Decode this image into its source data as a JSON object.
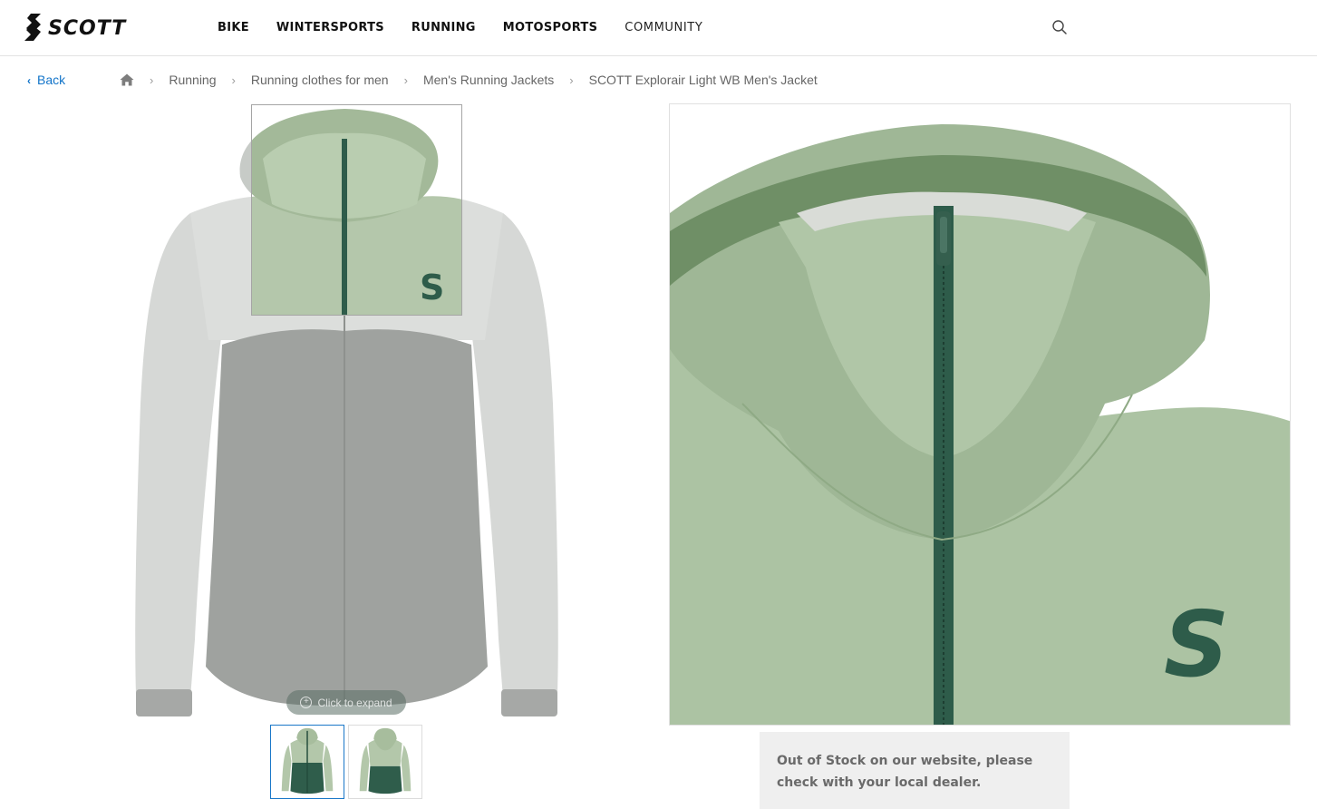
{
  "header": {
    "logo_text": "SCOTT",
    "nav": [
      {
        "label": "BIKE"
      },
      {
        "label": "WINTERSPORTS"
      },
      {
        "label": "RUNNING"
      },
      {
        "label": "MOTOSPORTS"
      },
      {
        "label": "COMMUNITY"
      }
    ],
    "search_icon": "search-icon"
  },
  "breadcrumb": {
    "back_label": "Back",
    "home_icon": "home-icon",
    "items": [
      {
        "label": "Running"
      },
      {
        "label": "Running clothes for men"
      },
      {
        "label": "Men's Running Jackets"
      },
      {
        "label": "SCOTT Explorair Light WB Men's Jacket"
      }
    ]
  },
  "gallery": {
    "expand_label": "Click to expand",
    "thumbnails": [
      {
        "view": "front",
        "selected": true
      },
      {
        "view": "back",
        "selected": false
      }
    ]
  },
  "stock_notice": "Out of Stock on our website, please check with your local dealer.",
  "colors": {
    "accent_link": "#1274c9",
    "jacket_light_green": "#a9bf9f",
    "jacket_dark_green": "#2e5c4a",
    "notice_bg": "#efefef"
  }
}
